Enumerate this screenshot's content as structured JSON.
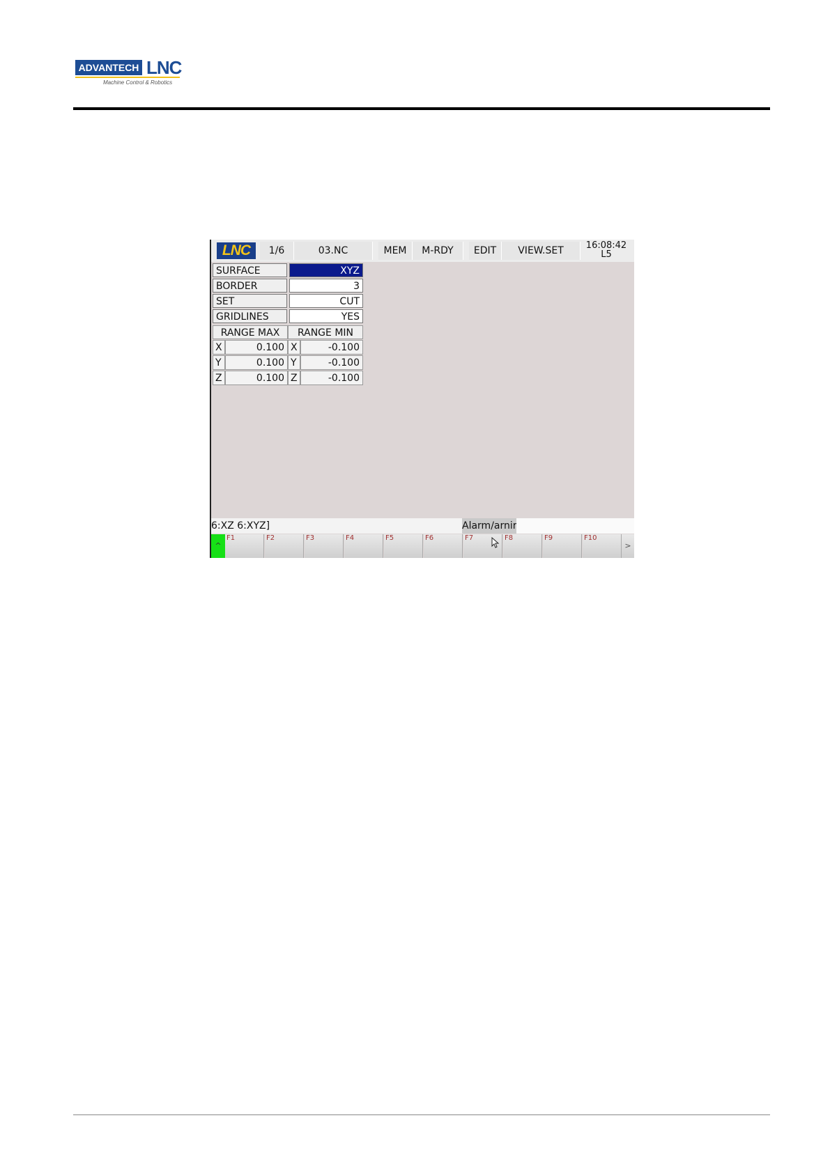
{
  "header": {
    "logo_left": "ADVANTECH",
    "logo_right": "LNC",
    "logo_tagline": "Machine Control & Robotics"
  },
  "screen": {
    "topbar": {
      "logo": "LNC",
      "page": "1/6",
      "program": "03.NC",
      "mode": "MEM",
      "status": "M-RDY",
      "edit": "EDIT",
      "view": "VIEW.SET",
      "time": "16:08:42",
      "level": "L5"
    },
    "params": [
      {
        "label": "SURFACE",
        "value": "XYZ",
        "selected": true
      },
      {
        "label": "BORDER",
        "value": "3"
      },
      {
        "label": "SET",
        "value": "CUT"
      },
      {
        "label": "GRIDLINES",
        "value": "YES"
      }
    ],
    "range": {
      "max_header": "RANGE MAX",
      "min_header": "RANGE MIN",
      "rows": [
        {
          "axis": "X",
          "max": "0.100",
          "min_axis": "X",
          "min": "-0.100"
        },
        {
          "axis": "Y",
          "max": "0.100",
          "min_axis": "Y",
          "min": "-0.100"
        },
        {
          "axis": "Z",
          "max": "0.100",
          "min_axis": "Z",
          "min": "-0.100"
        }
      ]
    },
    "command_line": "6:XZ 6:XYZ]",
    "alarm": "Alarm/arnir",
    "softkeys": {
      "up": "^",
      "keys": [
        "F1",
        "F2",
        "F3",
        "F4",
        "F5",
        "F6",
        "F7",
        "F8",
        "F9",
        "F10"
      ],
      "more": ">"
    }
  }
}
